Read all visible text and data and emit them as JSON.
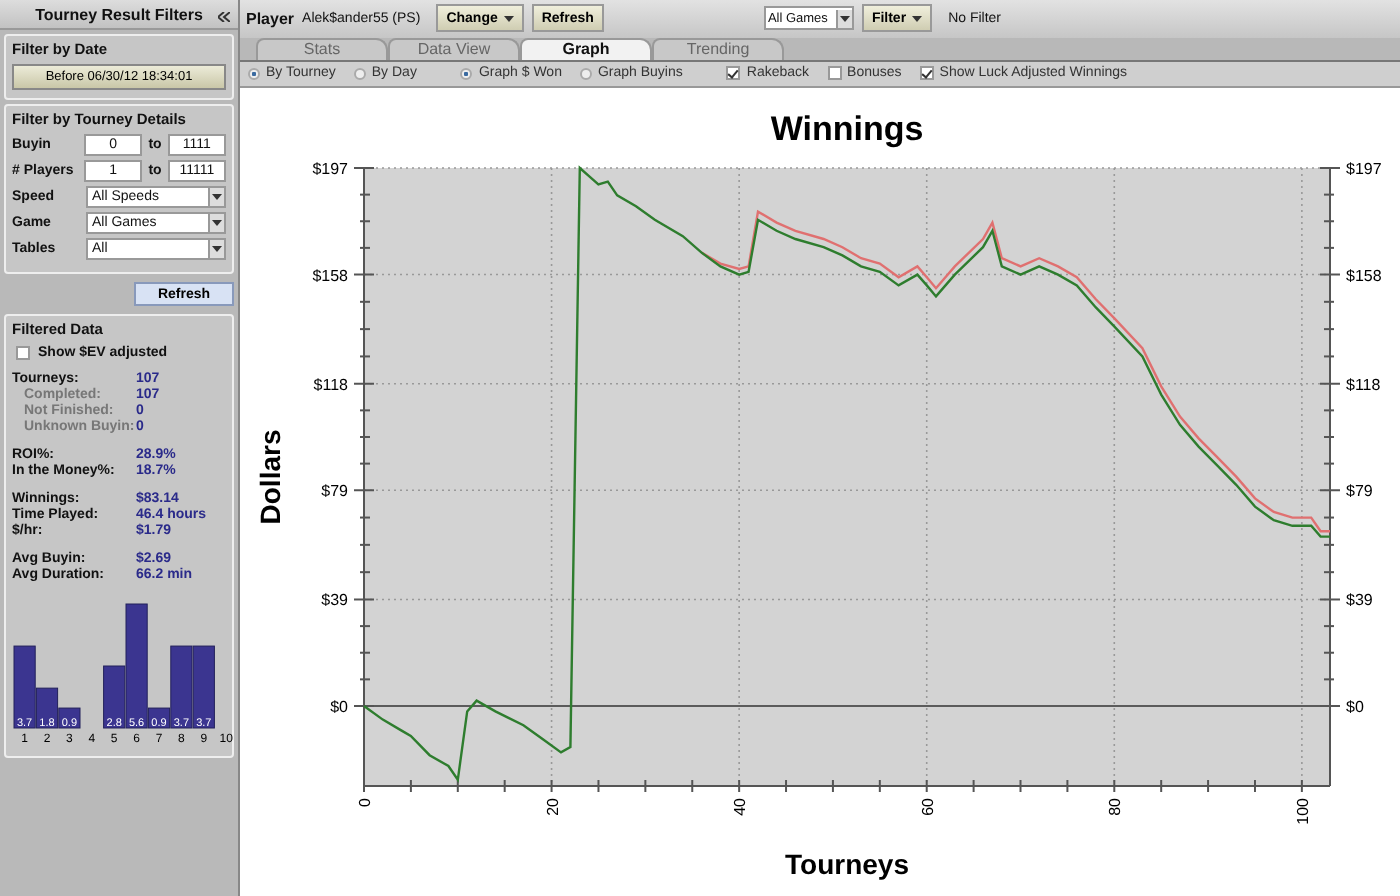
{
  "sidebar": {
    "title": "Tourney Result Filters",
    "date_filter": {
      "heading": "Filter by Date",
      "button": "Before 06/30/12 18:34:01"
    },
    "details_filter": {
      "heading": "Filter by Tourney Details",
      "ranges": [
        {
          "label": "Buyin",
          "from": "0",
          "to_label": "to",
          "to": "1111"
        },
        {
          "label": "# Players",
          "from": "1",
          "to_label": "to",
          "to": "11111"
        }
      ],
      "selects": [
        {
          "label": "Speed",
          "value": "All Speeds"
        },
        {
          "label": "Game",
          "value": "All Games"
        },
        {
          "label": "Tables",
          "value": "All"
        }
      ],
      "refresh_button": "Refresh"
    },
    "filtered_data": {
      "heading": "Filtered Data",
      "ev_checkbox": {
        "label": "Show $EV adjusted",
        "checked": false
      },
      "stat_groups": [
        [
          {
            "label": "Tourneys:",
            "value": "107",
            "kind": "main"
          },
          {
            "label": "Completed:",
            "value": "107",
            "kind": "sub"
          },
          {
            "label": "Not Finished:",
            "value": "0",
            "kind": "sub"
          },
          {
            "label": "Unknown Buyin:",
            "value": "0",
            "kind": "sub"
          }
        ],
        [
          {
            "label": "ROI%:",
            "value": "28.9%",
            "kind": "main"
          },
          {
            "label": "In the Money%:",
            "value": "18.7%",
            "kind": "main"
          }
        ],
        [
          {
            "label": "Winnings:",
            "value": "$83.14",
            "kind": "main"
          },
          {
            "label": "Time Played:",
            "value": "46.4 hours",
            "kind": "main"
          },
          {
            "label": "$/hr:",
            "value": "$1.79",
            "kind": "main"
          }
        ],
        [
          {
            "label": "Avg Buyin:",
            "value": "$2.69",
            "kind": "main"
          },
          {
            "label": "Avg Duration:",
            "value": "66.2 min",
            "kind": "main"
          }
        ]
      ],
      "chart_data": {
        "type": "bar",
        "categories": [
          "1",
          "2",
          "3",
          "4",
          "5",
          "6",
          "7",
          "8",
          "9",
          "10"
        ],
        "values": [
          3.7,
          1.8,
          0.9,
          null,
          2.8,
          5.6,
          0.9,
          3.7,
          3.7,
          null
        ],
        "data_labels": true
      }
    }
  },
  "toolbar": {
    "player_label": "Player",
    "player_name": "Alek$ander55 (PS)",
    "change_button": "Change",
    "refresh_button": "Refresh",
    "games_select": "All Games",
    "filter_button": "Filter",
    "filter_status": "No Filter"
  },
  "tabs": [
    {
      "label": "Stats",
      "selected": false
    },
    {
      "label": "Data View",
      "selected": false
    },
    {
      "label": "Graph",
      "selected": true
    },
    {
      "label": "Trending",
      "selected": false
    }
  ],
  "options": [
    {
      "kind": "radio",
      "label": "By Tourney",
      "selected": true
    },
    {
      "kind": "radio",
      "label": "By Day",
      "selected": false
    },
    {
      "kind": "radio",
      "label": "Graph $ Won",
      "selected": true
    },
    {
      "kind": "radio",
      "label": "Graph Buyins",
      "selected": false
    },
    {
      "kind": "checkbox",
      "label": "Rakeback",
      "checked": true
    },
    {
      "kind": "checkbox",
      "label": "Bonuses",
      "checked": false
    },
    {
      "kind": "checkbox",
      "label": "Show Luck Adjusted Winnings",
      "checked": true
    }
  ],
  "graph": {
    "chart_data": {
      "type": "line",
      "title": "Winnings",
      "xlabel": "Tourneys",
      "ylabel": "Dollars",
      "x": [
        0,
        2,
        4,
        5,
        7,
        9,
        10,
        11,
        12,
        14,
        17,
        19,
        21,
        22,
        23,
        24,
        25,
        26,
        27,
        29,
        31,
        34,
        36,
        38,
        40,
        41,
        42,
        44,
        46,
        49,
        51,
        53,
        55,
        57,
        59,
        60,
        61,
        63,
        66,
        67,
        68,
        70,
        72,
        74,
        76,
        78,
        80,
        83,
        85,
        87,
        89,
        91,
        93,
        95,
        97,
        99,
        101,
        102,
        103
      ],
      "series": [
        {
          "color": "#2e7d2e",
          "values": [
            0,
            -5,
            -9,
            -11,
            -18,
            -22,
            -27,
            -2,
            2,
            -2,
            -7,
            -12,
            -17,
            -15,
            197,
            194,
            191,
            192,
            187,
            183,
            178,
            172,
            166,
            161,
            158,
            159,
            178,
            174,
            171,
            168,
            165,
            161,
            159,
            154,
            158,
            154,
            150,
            158,
            168,
            174,
            161,
            158,
            161,
            158,
            154,
            146,
            139,
            128,
            114,
            103,
            95,
            88,
            81,
            73,
            68,
            66,
            66,
            62,
            62
          ]
        },
        {
          "color": "#e07070",
          "values": [
            null,
            null,
            null,
            null,
            null,
            null,
            null,
            null,
            null,
            null,
            null,
            null,
            null,
            null,
            null,
            null,
            null,
            null,
            null,
            null,
            null,
            null,
            166,
            162,
            160,
            161,
            181,
            177,
            174,
            171,
            168,
            164,
            162,
            157,
            161,
            157,
            153,
            161,
            171,
            177,
            164,
            161,
            164,
            161,
            157,
            149,
            142,
            131,
            117,
            106,
            98,
            91,
            84,
            76,
            71,
            69,
            69,
            64,
            64
          ]
        }
      ],
      "grid": true,
      "xlim": [
        0,
        103
      ],
      "ylim": [
        -29.3,
        197
      ],
      "xticks": [
        0,
        20,
        40,
        60,
        80,
        100
      ],
      "yticks": [
        {
          "value": 0,
          "label": "$0"
        },
        {
          "value": 39,
          "label": "$39"
        },
        {
          "value": 79,
          "label": "$79"
        },
        {
          "value": 118,
          "label": "$118"
        },
        {
          "value": 158,
          "label": "$158"
        },
        {
          "value": 197,
          "label": "$197"
        }
      ]
    }
  }
}
